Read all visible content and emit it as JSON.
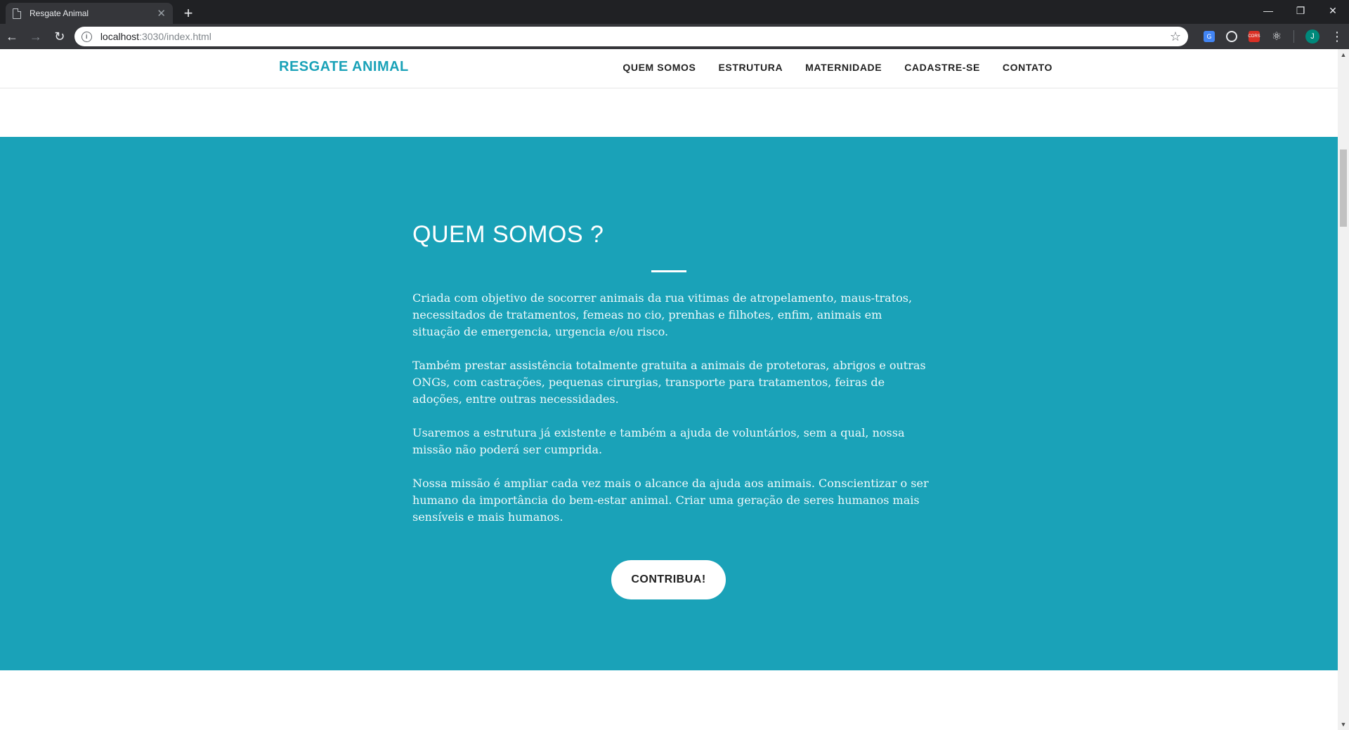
{
  "browser": {
    "tab_title": "Resgate Animal",
    "url_host": "localhost",
    "url_rest": ":3030/index.html",
    "profile_initial": "J",
    "ext_badge": "CORS"
  },
  "site": {
    "brand": "RESGATE ANIMAL",
    "nav": [
      {
        "label": "QUEM SOMOS"
      },
      {
        "label": "ESTRUTURA"
      },
      {
        "label": "MATERNIDADE"
      },
      {
        "label": "CADASTRE-SE"
      },
      {
        "label": "CONTATO"
      }
    ]
  },
  "about": {
    "title": "QUEM SOMOS ?",
    "paragraphs": [
      "Criada com objetivo de socorrer animais da rua vitimas de atropelamento, maus-tratos, necessitados de tratamentos, femeas no cio, prenhas e filhotes, enfim, animais em situação de emergencia, urgencia e/ou risco.",
      "Também prestar assistência totalmente gratuita a animais de protetoras, abrigos e outras ONGs, com castrações, pequenas cirurgias, transporte para tratamentos, feiras de adoções, entre outras necessidades.",
      "Usaremos a estrutura já existente e também a ajuda de voluntários, sem a qual, nossa missão não poderá ser cumprida.",
      "Nossa missão é ampliar cada vez mais o alcance da ajuda aos animais. Conscientizar o ser humano da importância do bem-estar animal. Criar uma geração de seres humanos mais sensíveis e mais humanos."
    ],
    "cta_label": "CONTRIBUA!"
  },
  "colors": {
    "brand": "#1aa2b8",
    "section_bg": "#1aa2b8"
  }
}
